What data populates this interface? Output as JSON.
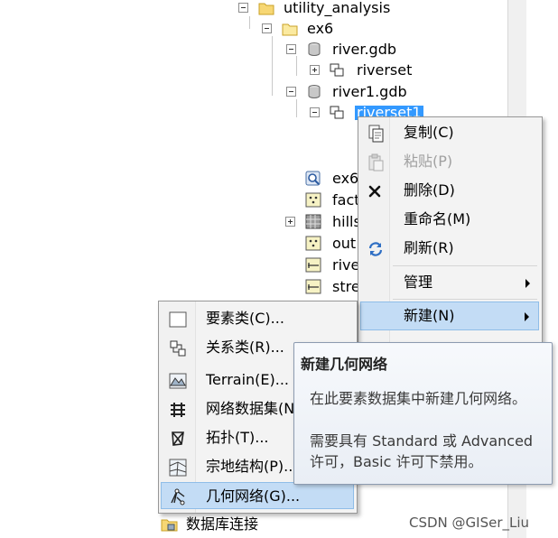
{
  "tree": {
    "utility_analysis": "utility_analysis",
    "ex6": "ex6",
    "river_gdb": "river.gdb",
    "riverset": "riverset",
    "river1_gdb": "river1.gdb",
    "riverset1": "riverset1",
    "ex6_partial": "ex6",
    "fact_partial": "fact",
    "hills_partial": "hills",
    "out_partial": "out",
    "rive_partial": "rive",
    "stre_partial": "stre"
  },
  "context_menu": {
    "copy": "复制(C)",
    "paste": "粘贴(P)",
    "delete": "删除(D)",
    "rename": "重命名(M)",
    "refresh": "刷新(R)",
    "manage": "管理",
    "new": "新建(N)"
  },
  "submenu": {
    "feature_class": "要素类(C)...",
    "relationship_class": "关系类(R)...",
    "terrain": "Terrain(E)...",
    "network_dataset": "网络数据集(N",
    "topology": "拓扑(T)...",
    "parcel_fabric": "宗地结构(P)...",
    "geometric_network": "几何网络(G)..."
  },
  "tooltip": {
    "title": "新建几何网络",
    "line1": "在此要素数据集中新建几何网络。",
    "line2": "需要具有 Standard 或 Advanced",
    "line3": "许可，Basic 许可下禁用。"
  },
  "bottom": {
    "db_connections": "数据库连接"
  },
  "watermark": "CSDN @GISer_Liu",
  "colors": {
    "selection": "#3399ff",
    "menu_highlight": "#c3dcf5",
    "menu_bg": "#f3f3f3"
  }
}
